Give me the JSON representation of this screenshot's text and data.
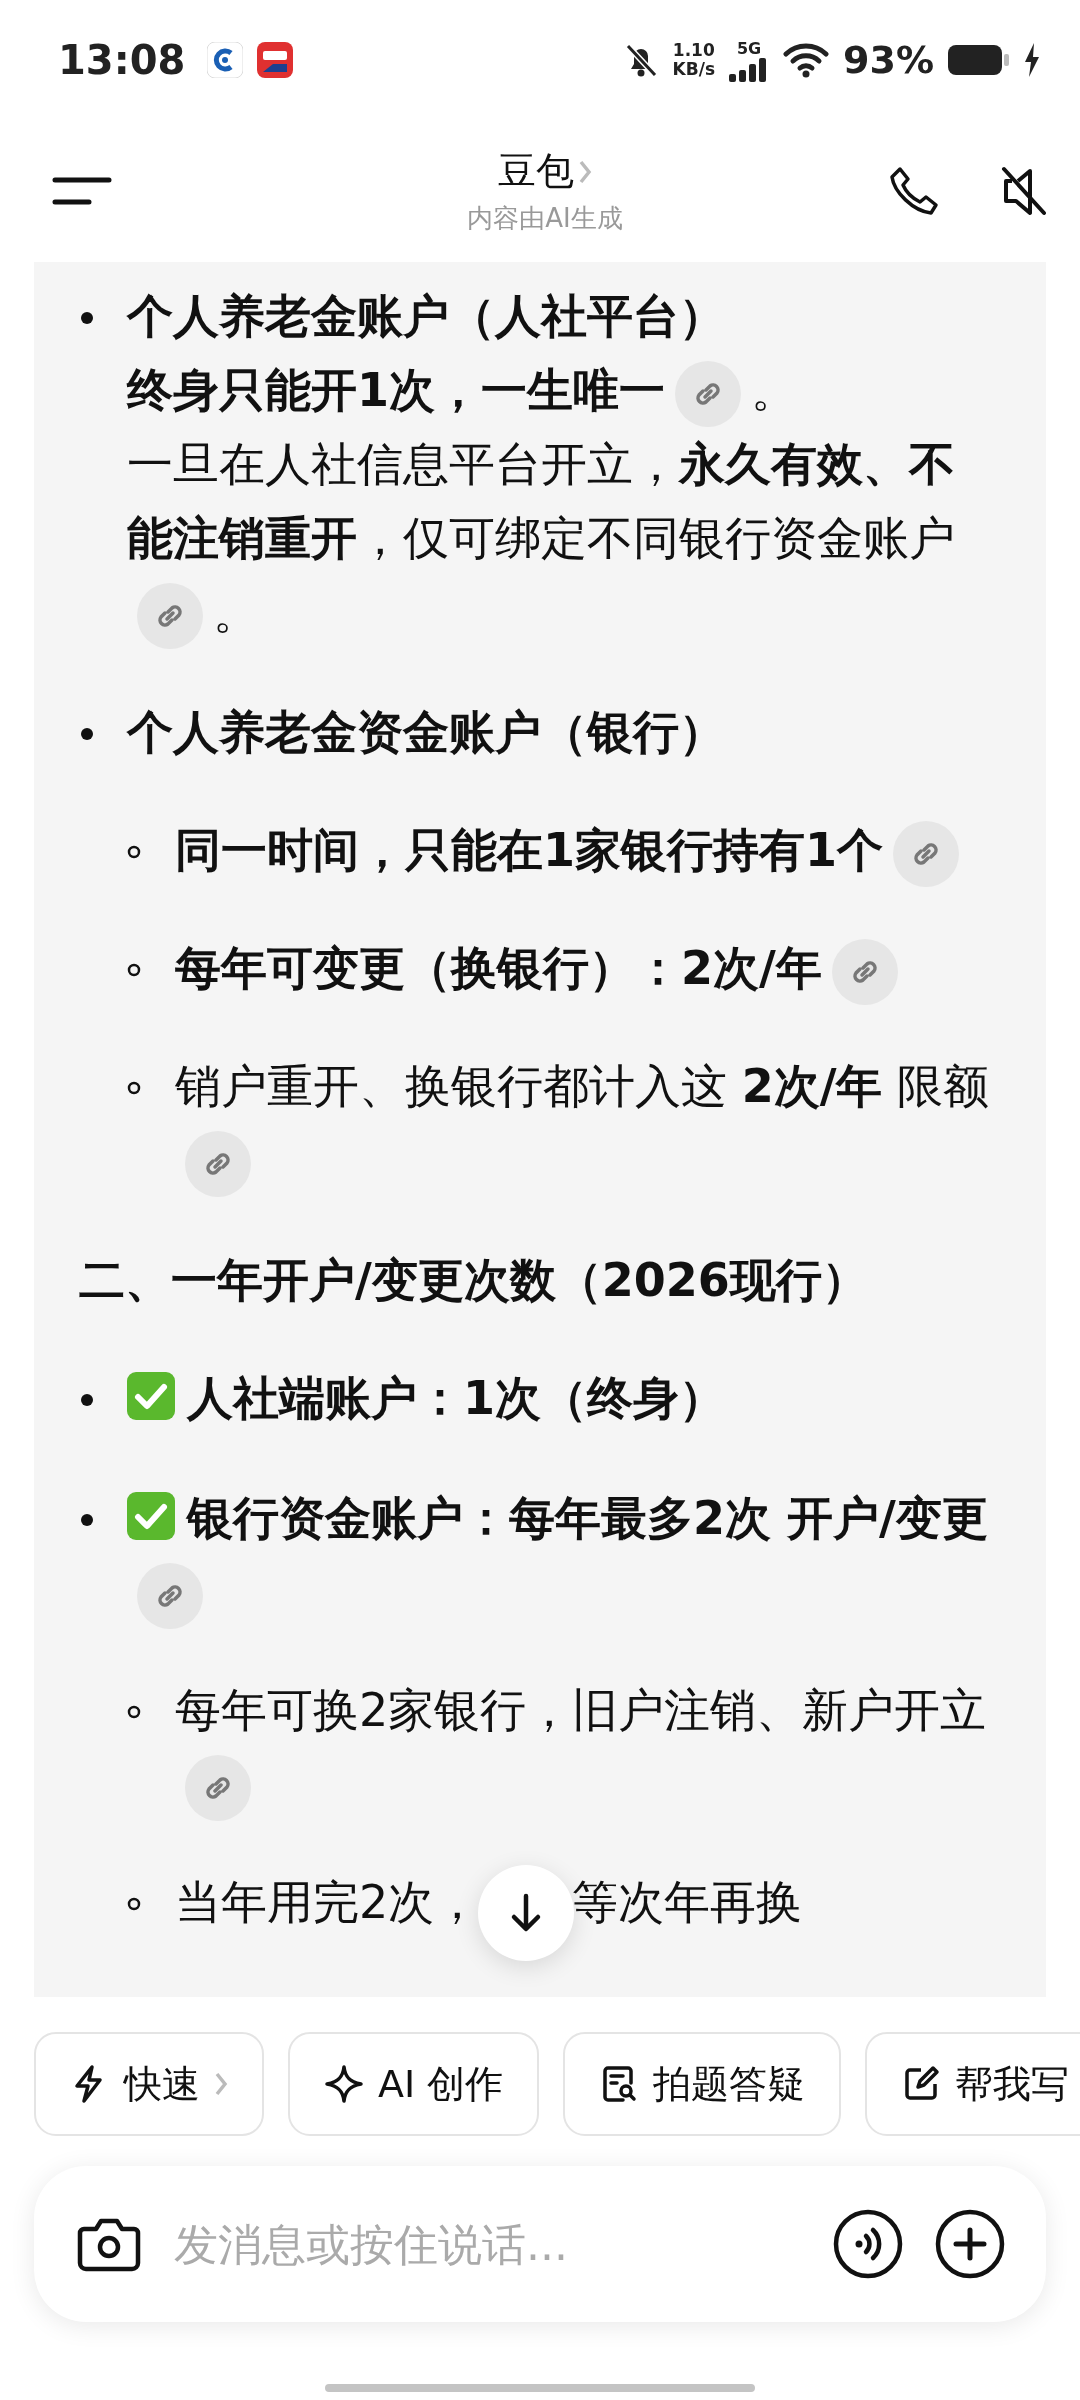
{
  "status_bar": {
    "time": "13:08",
    "net_speed": "1.10",
    "net_unit": "KB/s",
    "network": "5G",
    "battery": "93%"
  },
  "header": {
    "title": "豆包",
    "subtitle": "内容由AI生成"
  },
  "blocks": [
    {
      "kind": "item",
      "check_mark": false,
      "segments": [
        {
          "kind": "text",
          "bold": true,
          "text": "个人养老金账户（人社平台）"
        },
        {
          "kind": "break"
        },
        {
          "kind": "text",
          "bold": true,
          "text": "终身只能开1次，一生唯一"
        },
        {
          "kind": "link"
        },
        {
          "kind": "text",
          "bold": false,
          "text": "。"
        },
        {
          "kind": "break"
        },
        {
          "kind": "text",
          "bold": false,
          "text": "一旦在人社信息平台开立，**永久有效、不能注销重开**，仅可绑定不同银行资金账户"
        },
        {
          "kind": "link"
        },
        {
          "kind": "text",
          "bold": false,
          "text": "。"
        }
      ]
    },
    {
      "kind": "item",
      "check_mark": false,
      "segments": [
        {
          "kind": "text",
          "bold": true,
          "text": "个人养老金资金账户（银行）"
        }
      ],
      "children": [
        {
          "segments": [
            {
              "kind": "text",
              "bold": true,
              "text": "同一时间，只能在1家银行持有1个"
            },
            {
              "kind": "link"
            }
          ]
        },
        {
          "segments": [
            {
              "kind": "text",
              "bold": true,
              "text": "每年可变更（换银行）：2次/年"
            },
            {
              "kind": "link"
            }
          ]
        },
        {
          "segments": [
            {
              "kind": "text",
              "bold": false,
              "text": "销户重开、换银行都计入这 **2次/年** 限额"
            },
            {
              "kind": "link"
            }
          ]
        }
      ]
    },
    {
      "kind": "heading",
      "text": "二、一年开户/变更次数（2026现行）"
    },
    {
      "kind": "item",
      "check_mark": true,
      "segments": [
        {
          "kind": "text",
          "bold": true,
          "text": "人社端账户：1次（终身）"
        }
      ]
    },
    {
      "kind": "item",
      "check_mark": true,
      "segments": [
        {
          "kind": "text",
          "bold": true,
          "text": "银行资金账户：每年最多2次 开户/变更"
        },
        {
          "kind": "link"
        }
      ],
      "children": [
        {
          "segments": [
            {
              "kind": "text",
              "bold": false,
              "text": "每年可换2家银行，旧户注销、新户开立"
            },
            {
              "kind": "link"
            }
          ]
        },
        {
          "segments": [
            {
              "kind": "text",
              "bold": false,
              "text": "当年用完2次，"
            },
            {
              "kind": "covered"
            },
            {
              "kind": "text",
              "bold": false,
              "text": "等次年再换"
            }
          ]
        }
      ]
    }
  ],
  "chips": [
    {
      "label": "快速",
      "chevron": true
    },
    {
      "label": "AI 创作",
      "chevron": false
    },
    {
      "label": "拍题答疑",
      "chevron": false
    },
    {
      "label": "帮我写",
      "chevron": false
    }
  ],
  "input": {
    "placeholder": "发消息或按住说话..."
  }
}
